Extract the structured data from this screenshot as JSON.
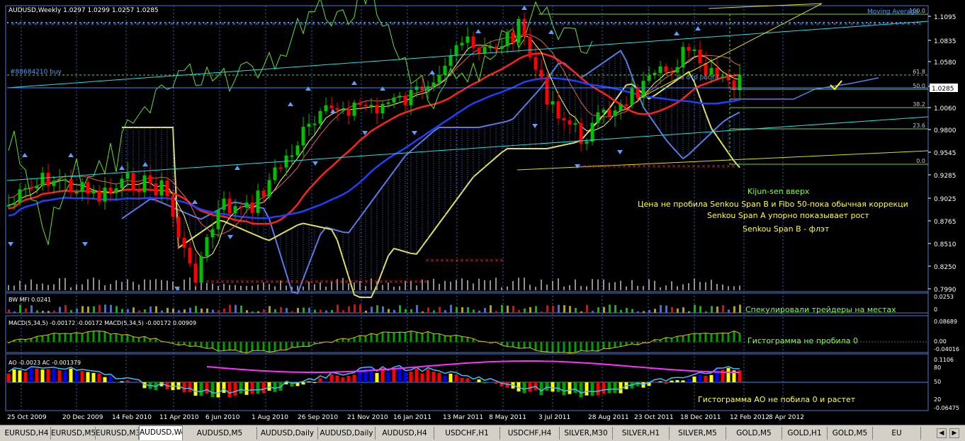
{
  "window": {
    "symbol_info": "AUDUSD,Weekly  1.0297 1.0299 1.0257 1.0285",
    "indicator_label": "Moving Average",
    "position_label": "#88684210 buy",
    "current_price": "1.0285"
  },
  "price_scale": [
    "1.1095",
    "1.0835",
    "1.0580",
    "1.0325",
    "1.0060",
    "0.9800",
    "0.9545",
    "0.9285",
    "0.9025",
    "0.8765",
    "0.8510",
    "0.8250",
    "0.7990"
  ],
  "fibo_levels": [
    "100.0",
    "61.8",
    "50.0",
    "38.2",
    "23.6",
    "0.0"
  ],
  "annotations": {
    "kijun": "Kijun-sen вверх",
    "price_note": "Цена не пробила Senkou Span B и Fibo 50-пока обычная коррекци",
    "span_a": "Senkou Span A упорно показывает рост",
    "span_b": "Senkou Span B - флэт",
    "mfi_note": "Спекулировали трейдеры на местах",
    "macd_note": "Гистограмма не пробила 0",
    "ao_note": "Гистограмма АО не побила 0 и растет",
    "trend_text": "са отр роста"
  },
  "mfi": {
    "label": "BW MFI 0.0241",
    "scale": [
      "0.0253",
      "0"
    ]
  },
  "macd": {
    "label": "MACD(5,34,5) -0.00172 -0.00172 MACD(5,34,5) -0.00172 0.00909",
    "scale": [
      "0.08689",
      "0.00",
      "-0.04016"
    ]
  },
  "ao": {
    "label": "AO -0.0023 AC -0.001379",
    "scale": [
      "0.1106",
      "80",
      "50",
      "20",
      "-0.06475"
    ]
  },
  "dates": [
    "25 Oct 2009",
    "20 Dec 2009",
    "14 Feb 2010",
    "11 Apr 2010",
    "6 Jun 2010",
    "1 Aug 2010",
    "26 Sep 2010",
    "21 Nov 2010",
    "16 Jan 2011",
    "13 Mar 2011",
    "8 May 2011",
    "3 Jul 2011",
    "28 Aug 2011",
    "23 Oct 2011",
    "18 Dec 2011",
    "12 Feb 2012",
    "8 Apr 2012"
  ],
  "tabs": [
    "EURUSD,H4",
    "EURUSD,M5",
    "EURUSD,M30",
    "AUDUSD,Weekly",
    "AUDUSD,M5",
    "AUDUSD,Daily",
    "AUDUSD,Daily",
    "AUDUSD,H4",
    "USDCHF,H1",
    "USDCHF,H4",
    "SILVER,M30",
    "SILVER,H1",
    "SILVER,M5",
    "GOLD,M5",
    "GOLD,H1",
    "GOLD,M5",
    "EU"
  ],
  "active_tab": "AUDUSD,Weekly",
  "colors": {
    "background": "#000000",
    "bull": "#00c000",
    "bear": "#ff0000",
    "axis": "#4a78c8",
    "text": "#ffffff",
    "tab_bg": "#d4d0c8"
  }
}
